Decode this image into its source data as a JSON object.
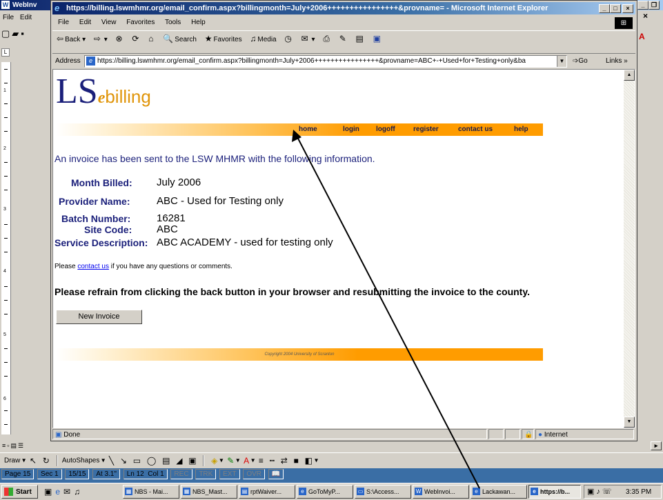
{
  "word": {
    "title": "WebInv",
    "menu": [
      "File",
      "Edit"
    ],
    "status": {
      "page": "Page 15",
      "sec": "Sec 1",
      "pages": "15/15",
      "at": "At 3.1\"",
      "ln": "Ln 12",
      "col": "Col 1",
      "rec": "REC",
      "trk": "TRK",
      "ext": "EXT",
      "ovr": "OVR"
    },
    "draw_label": "Draw",
    "autoshapes_label": "AutoShapes",
    "ruler_numbers": [
      "1",
      "2",
      "3",
      "4",
      "5",
      "6"
    ]
  },
  "ie": {
    "title": "https://billing.lswmhmr.org/email_confirm.aspx?billingmonth=July+2006++++++++++++++++&provname= - Microsoft Internet Explorer",
    "menu": [
      "File",
      "Edit",
      "View",
      "Favorites",
      "Tools",
      "Help"
    ],
    "toolbar": {
      "back": "Back",
      "search": "Search",
      "favorites": "Favorites",
      "media": "Media"
    },
    "address_label": "Address",
    "address_url": "https://billing.lswmhmr.org/email_confirm.aspx?billingmonth=July+2006++++++++++++++++&provname=ABC+-+Used+for+Testing+only&ba",
    "go_label": "Go",
    "links_label": "Links",
    "status_text": "Done",
    "zone_text": "Internet"
  },
  "page": {
    "logo": {
      "big": "LS",
      "e": "e",
      "rest": "billing"
    },
    "nav": [
      "home",
      "login",
      "logoff",
      "register",
      "contact us",
      "help"
    ],
    "headline": "An invoice has been sent to the LSW MHMR with the following information.",
    "fields": [
      {
        "label": "Month Billed:",
        "value": "July 2006"
      },
      {
        "label": "Provider Name:",
        "value": "ABC - Used for Testing only"
      },
      {
        "label": "Batch Number:",
        "value": "16281"
      },
      {
        "label": "Site Code:",
        "value": "ABC"
      },
      {
        "label": "Service Description:",
        "value": "ABC ACADEMY - used for testing only"
      }
    ],
    "contact": {
      "before": "Please ",
      "link": "contact us",
      "after": " if you have any questions or comments."
    },
    "warning": "Please refrain from clicking the back button in your browser and resubmitting the invoice to the county.",
    "button_label": "New Invoice",
    "footer": "Copyright 2004  University of Scranton"
  },
  "taskbar": {
    "start": "Start",
    "tasks": [
      {
        "label": "NBS - Mai...",
        "active": false
      },
      {
        "label": "NBS_Mast...",
        "active": false
      },
      {
        "label": "rptWaiver...",
        "active": false
      },
      {
        "label": "GoToMyP...",
        "active": false
      },
      {
        "label": "S:\\Access...",
        "active": false
      },
      {
        "label": "WebInvoi...",
        "active": false
      },
      {
        "label": "Lackawan...",
        "active": false
      },
      {
        "label": "https://b...",
        "active": true
      }
    ],
    "clock": "3:35 PM"
  },
  "colors": {
    "brand_navy": "#1a1f7a",
    "brand_orange": "#ff9c00",
    "title_blue": "#0a246a"
  }
}
